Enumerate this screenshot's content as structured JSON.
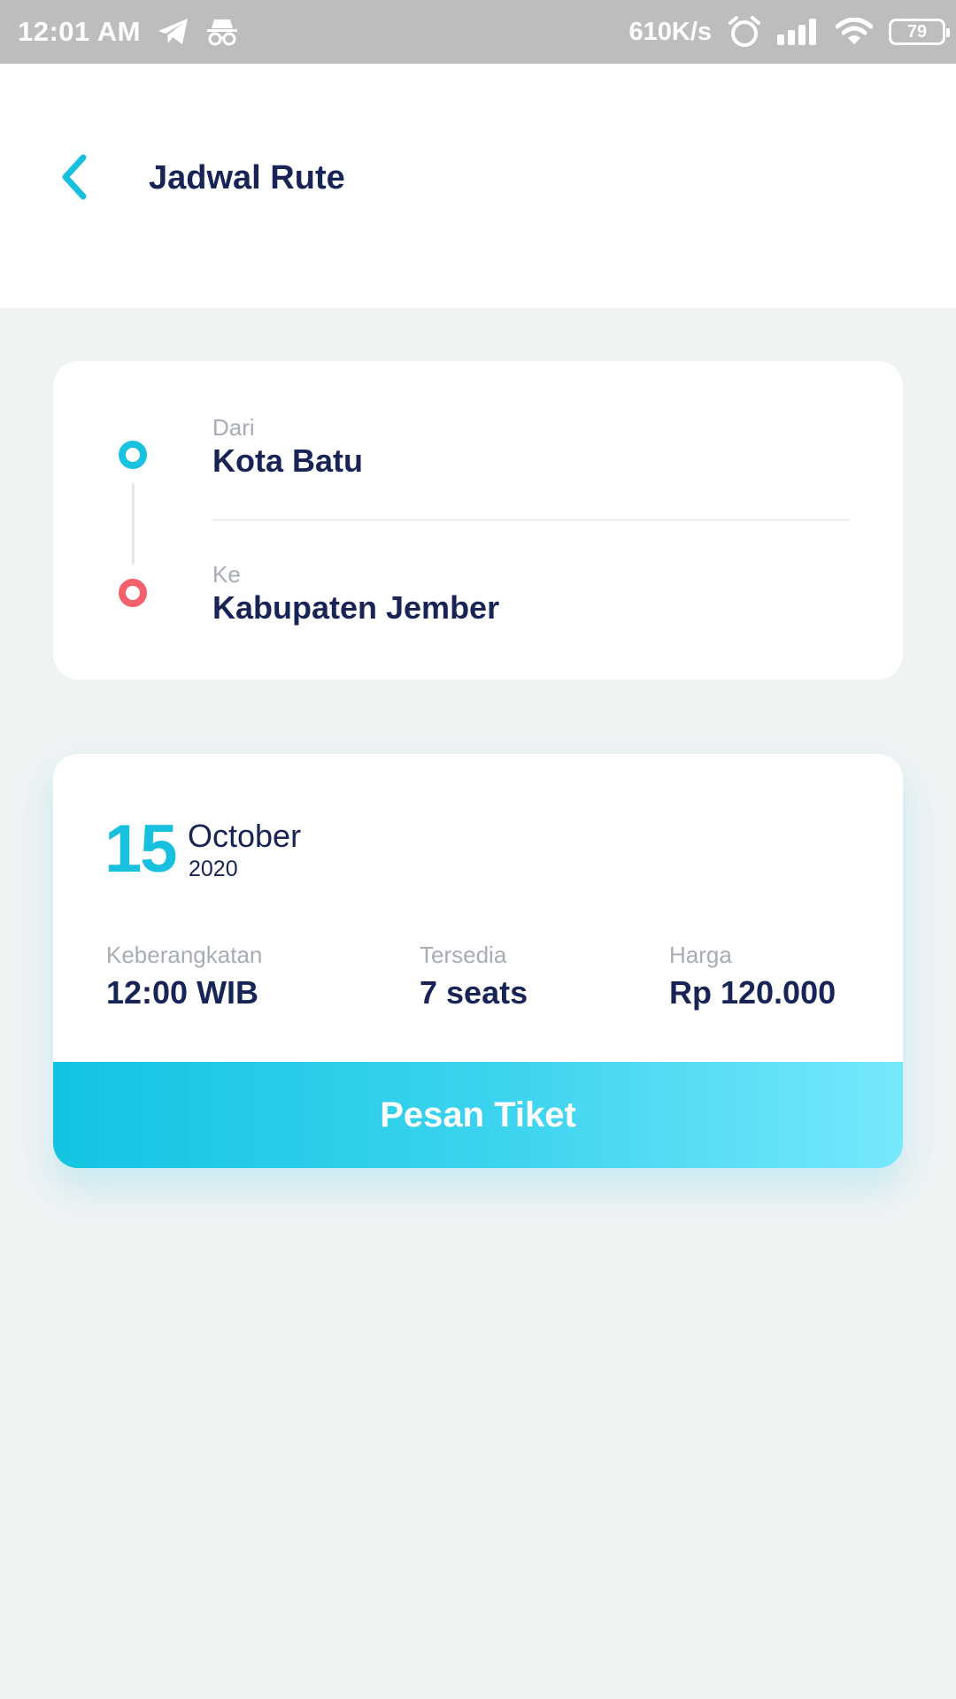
{
  "status_bar": {
    "time": "12:01 AM",
    "net_speed": "610K/s",
    "battery": "79",
    "icons": [
      "telegram-icon",
      "incognito-icon",
      "alarm-icon",
      "signal-icon",
      "wifi-icon",
      "battery-icon"
    ]
  },
  "header": {
    "title": "Jadwal Rute",
    "back_icon": "chevron-left-icon"
  },
  "route": {
    "from_label": "Dari",
    "from_value": "Kota Batu",
    "to_label": "Ke",
    "to_value": "Kabupaten Jember"
  },
  "schedule": {
    "day": "15",
    "month": "October",
    "year": "2020",
    "departure_label": "Keberangkatan",
    "departure_value": "12:00 WIB",
    "seats_label": "Tersedia",
    "seats_value": "7 seats",
    "price_label": "Harga",
    "price_value": "Rp 120.000",
    "book_button": "Pesan Tiket"
  },
  "colors": {
    "accent": "#17c0df",
    "destination": "#f2616c",
    "text_primary": "#172455",
    "text_secondary": "#a7adb3",
    "background": "#eff3f4"
  }
}
